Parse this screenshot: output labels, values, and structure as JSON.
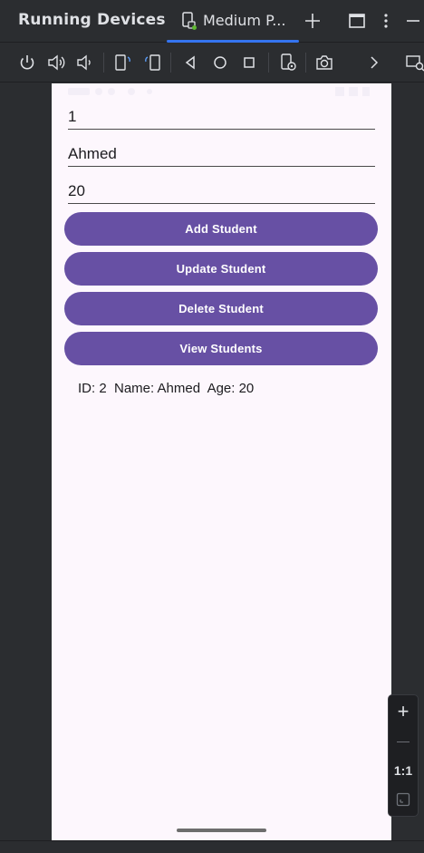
{
  "panel": {
    "title": "Running Devices"
  },
  "tab": {
    "label": "Medium P..."
  },
  "form": {
    "id_value": "1",
    "name_value": "Ahmed",
    "age_value": "20"
  },
  "buttons": {
    "add": "Add Student",
    "update": "Update Student",
    "delete": "Delete Student",
    "view": "View Students"
  },
  "result": {
    "text": "ID: 2  Name: Ahmed  Age: 20"
  },
  "zoom": {
    "plus": "+",
    "minus": "—",
    "actual": "1:1"
  },
  "colors": {
    "accent": "#3574f0",
    "button": "#6750a4",
    "screen_bg": "#fdf7fd",
    "ide_bg": "#2b2d30"
  }
}
